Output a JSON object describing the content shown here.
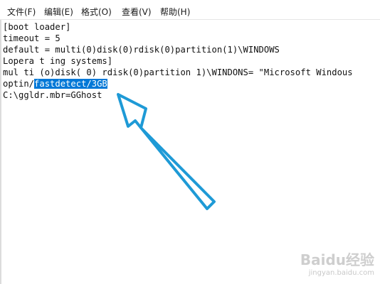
{
  "menubar": {
    "items": [
      {
        "label": "文件(F)"
      },
      {
        "label": "编辑(E)"
      },
      {
        "label": "格式(O)"
      },
      {
        "label": "查看(V)"
      },
      {
        "label": "帮助(H)"
      }
    ]
  },
  "editor": {
    "lines": [
      "[boot loader]",
      "timeout = 5",
      "default = multi(0)disk(0)rdisk(0)partition(1)\\WINDOWS",
      "Lopera t ing systems]",
      "mul ti (o)disk( 0) rdisk(0)partition 1)\\WINDONS= \"Microsoft Windous"
    ],
    "line6_prefix": "optin/",
    "line6_selected": "fastdetect/3GB",
    "line7": "C:\\ggldr.mbr=GGhost"
  },
  "colors": {
    "selection": "#0078d7",
    "arrow": "#1e9ad6"
  },
  "icons": {
    "annotation": "arrow-icon"
  },
  "watermark": {
    "main": "Baidu经验",
    "sub": "jingyan.baidu.com"
  }
}
